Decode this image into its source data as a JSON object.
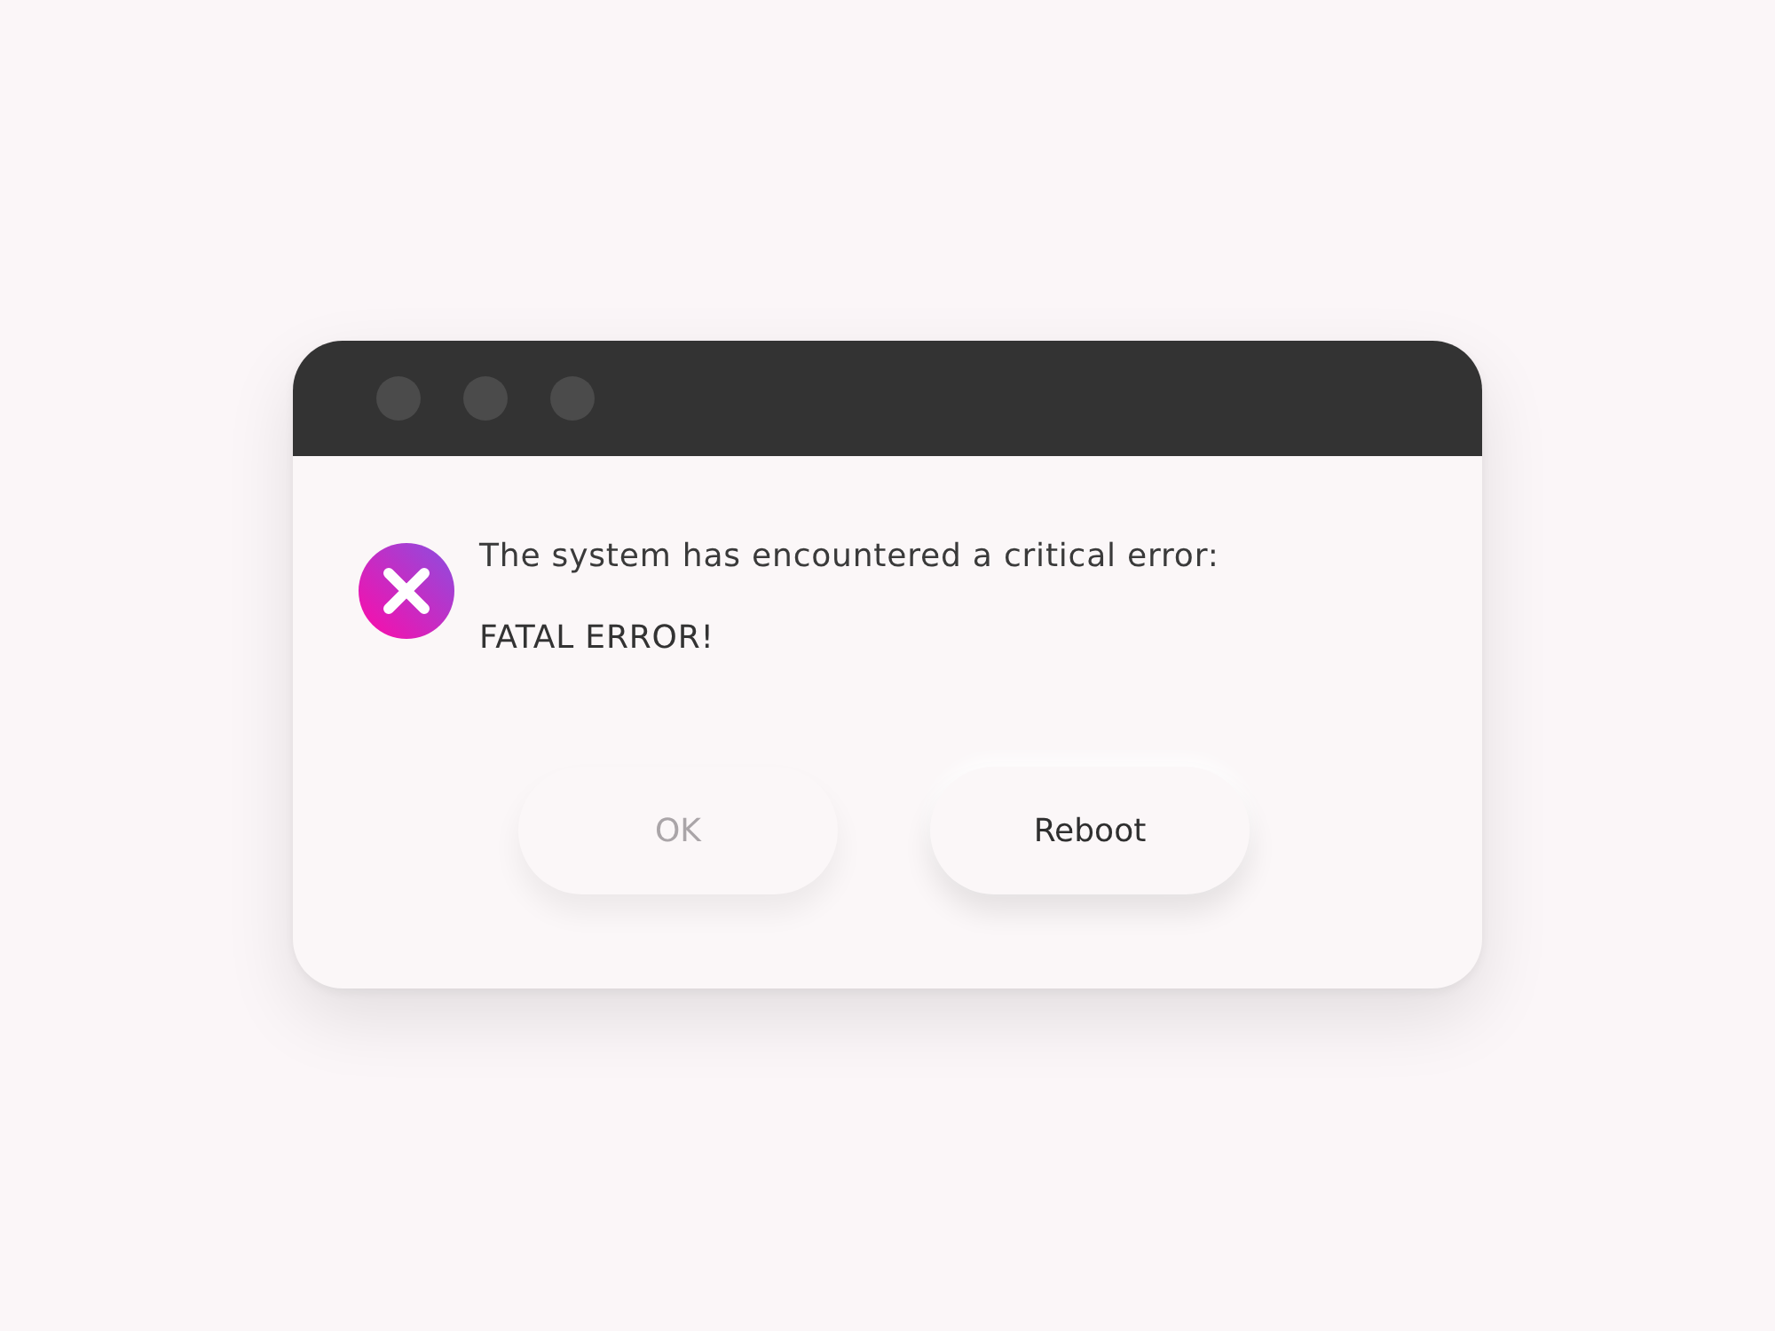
{
  "dialog": {
    "message": "The system has encountered a critical error:",
    "detail": "FATAL ERROR!",
    "buttons": [
      {
        "label": "OK",
        "disabled": true
      },
      {
        "label": "Reboot",
        "disabled": false
      }
    ]
  }
}
